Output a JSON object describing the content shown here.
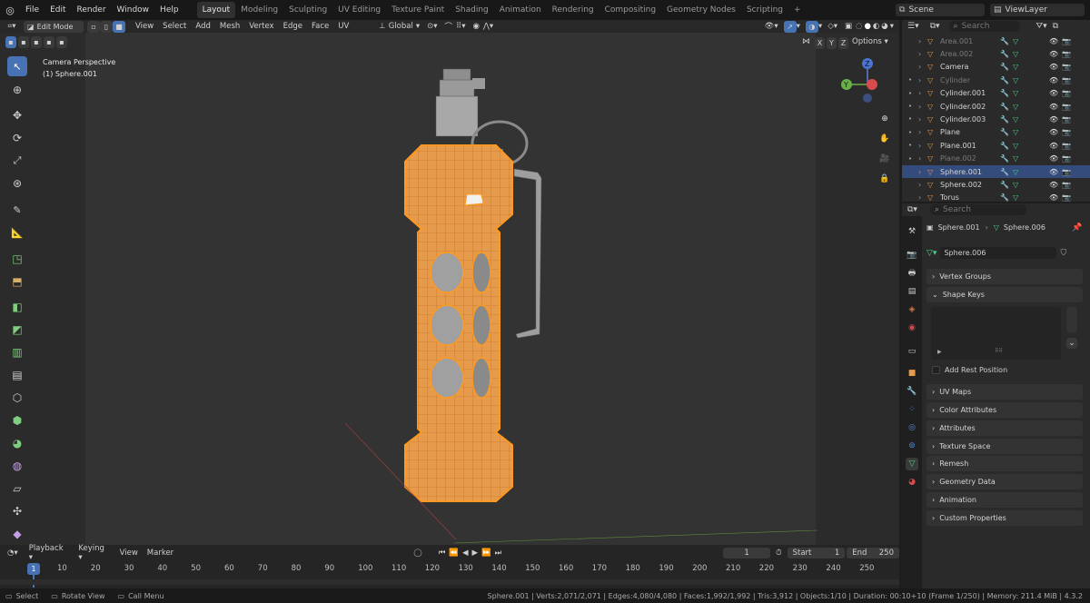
{
  "topbar": {
    "menus": [
      "File",
      "Edit",
      "Render",
      "Window",
      "Help"
    ],
    "workspaces": [
      "Layout",
      "Modeling",
      "Sculpting",
      "UV Editing",
      "Texture Paint",
      "Shading",
      "Animation",
      "Rendering",
      "Compositing",
      "Geometry Nodes",
      "Scripting"
    ],
    "active_workspace": "Layout",
    "add_tab": "+",
    "scene": "Scene",
    "view_layer": "ViewLayer"
  },
  "viewport_header": {
    "mode": "Edit Mode",
    "menus": [
      "View",
      "Select",
      "Add",
      "Mesh",
      "Vertex",
      "Edge",
      "Face",
      "UV"
    ],
    "orientation": "Global",
    "options": "Options",
    "axes": [
      "X",
      "Y",
      "Z"
    ]
  },
  "viewport": {
    "camera_label": "Camera Perspective",
    "object_label": "(1) Sphere.001",
    "gizmo": {
      "z": "Z",
      "y": "Y"
    }
  },
  "outliner": {
    "search_placeholder": "Search",
    "items": [
      {
        "name": "Area.001",
        "dim": true
      },
      {
        "name": "Area.002",
        "dim": true
      },
      {
        "name": "Camera",
        "dim": false
      },
      {
        "name": "Cylinder",
        "dim": true
      },
      {
        "name": "Cylinder.001",
        "dim": false
      },
      {
        "name": "Cylinder.002",
        "dim": false
      },
      {
        "name": "Cylinder.003",
        "dim": false
      },
      {
        "name": "Plane",
        "dim": false
      },
      {
        "name": "Plane.001",
        "dim": false
      },
      {
        "name": "Plane.002",
        "dim": true
      },
      {
        "name": "Sphere.001",
        "dim": false,
        "selected": true
      },
      {
        "name": "Sphere.002",
        "dim": false
      },
      {
        "name": "Torus",
        "dim": false
      }
    ]
  },
  "properties": {
    "search_placeholder": "Search",
    "object": "Sphere.001",
    "mesh": "Sphere.006",
    "mesh_field": "Sphere.006",
    "panels": {
      "vertex_groups": "Vertex Groups",
      "shape_keys": "Shape Keys",
      "add_rest_position": "Add Rest Position",
      "uv_maps": "UV Maps",
      "color_attributes": "Color Attributes",
      "attributes": "Attributes",
      "texture_space": "Texture Space",
      "remesh": "Remesh",
      "geometry_data": "Geometry Data",
      "animation": "Animation",
      "custom_properties": "Custom Properties"
    }
  },
  "timeline": {
    "menus": [
      "Playback",
      "Keying",
      "View",
      "Marker"
    ],
    "current_frame": "1",
    "start_label": "Start",
    "start": "1",
    "end_label": "End",
    "end": "250",
    "playhead": "1",
    "ticks": [
      "10",
      "20",
      "30",
      "40",
      "50",
      "60",
      "70",
      "80",
      "90",
      "100",
      "110",
      "120",
      "130",
      "140",
      "150",
      "160",
      "170",
      "180",
      "190",
      "200",
      "210",
      "220",
      "230",
      "240",
      "250"
    ]
  },
  "statusbar": {
    "select": "Select",
    "rotate": "Rotate View",
    "call_menu": "Call Menu",
    "stats": "Sphere.001 | Verts:2,071/2,071 | Edges:4,080/4,080 | Faces:1,992/1,992 | Tris:3,912 | Objects:1/10 | Duration: 00:10+10 (Frame 1/250) | Memory: 211.4 MiB | 4.3.2"
  },
  "colors": {
    "accent": "#4772b3",
    "selection": "#ff9a1f",
    "mesh_orange": "#e69a4c",
    "viewport_bg": "#2b2b2b"
  }
}
